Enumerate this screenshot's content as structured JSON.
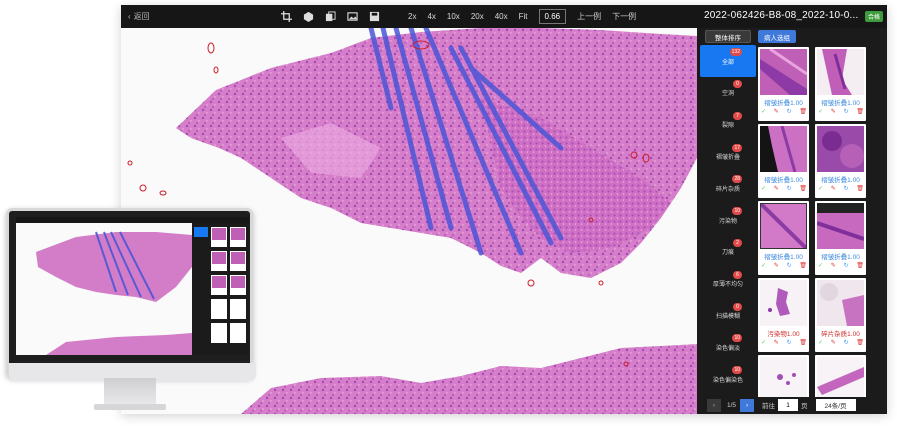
{
  "toolbar": {
    "back_label": "返回",
    "zoom_levels": [
      "2x",
      "4x",
      "10x",
      "20x",
      "40x",
      "Fit"
    ],
    "scale_value": "0.66",
    "prev_label": "上一例",
    "next_label": "下一例",
    "case_title": "2022-062426-B8-08_2022-10-0...",
    "status_badge": "合格"
  },
  "panel": {
    "sort_label": "整体排序",
    "select_label": "病人选组",
    "categories": [
      {
        "label": "全部",
        "count": "132"
      },
      {
        "label": "空洞",
        "count": "0"
      },
      {
        "label": "裂隙",
        "count": "7"
      },
      {
        "label": "褶皱折叠",
        "count": "17"
      },
      {
        "label": "碎片杂质",
        "count": "28"
      },
      {
        "label": "污染物",
        "count": "10"
      },
      {
        "label": "刀痕",
        "count": "2"
      },
      {
        "label": "厚薄不均匀",
        "count": "6"
      },
      {
        "label": "扫描模糊",
        "count": "0"
      },
      {
        "label": "染色偏淡",
        "count": "10"
      },
      {
        "label": "染色偏染色",
        "count": "10"
      }
    ],
    "cards": [
      {
        "label": "褶皱折叠1.00"
      },
      {
        "label": "褶皱折叠1.00"
      },
      {
        "label": "褶皱折叠1.00"
      },
      {
        "label": "褶皱折叠1.00"
      },
      {
        "label": "褶皱折叠1.00"
      },
      {
        "label": "褶皱折叠1.00"
      },
      {
        "label": "污染物1.00"
      },
      {
        "label": "碎片杂质1.00"
      },
      {
        "label": ""
      },
      {
        "label": ""
      }
    ],
    "pager": {
      "page_info": "1/5",
      "goto_label": "前往",
      "page_input": "1",
      "page_unit": "页",
      "page_size": "24条/页"
    }
  },
  "colors": {
    "accent": "#1778f2",
    "count_badge": "#e24a4a",
    "label_blue": "#3d8bdf",
    "label_red": "#d02a2a",
    "badge_green": "#3e9b3e",
    "tissue_pink": "#d873c7",
    "marker_blue": "#4c56d6"
  },
  "icons": [
    "back-icon",
    "crop-icon",
    "cube-icon",
    "copy-icon",
    "image-icon",
    "save-icon",
    "check-icon",
    "edit-icon",
    "rotate-icon",
    "trash-icon"
  ]
}
